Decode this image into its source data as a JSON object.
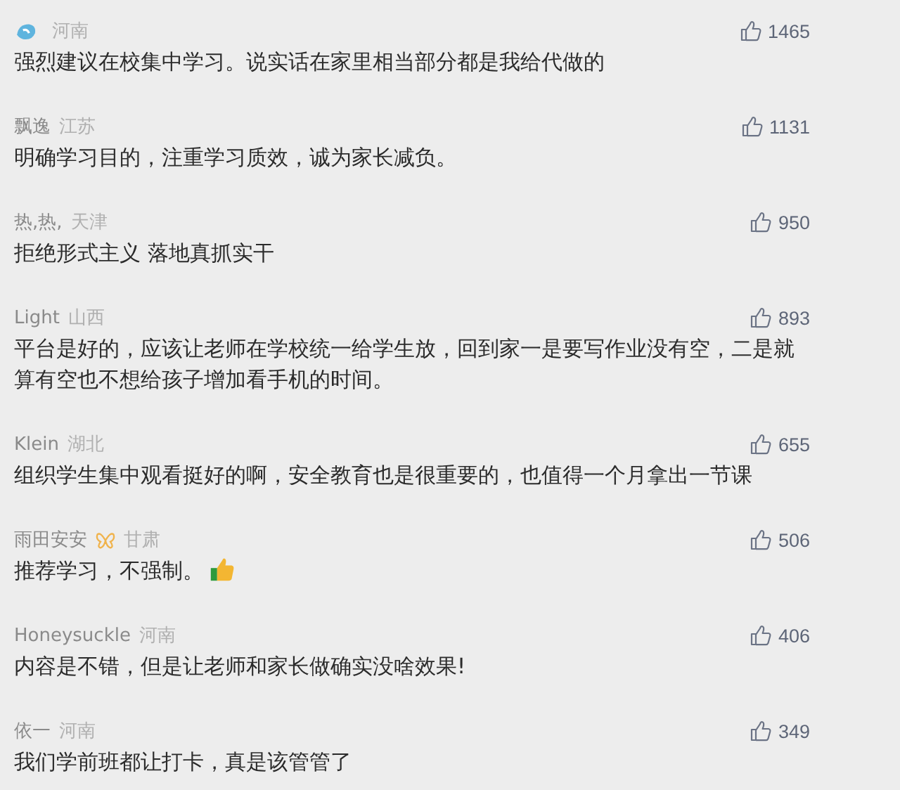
{
  "comments": [
    {
      "kind": "avatar",
      "location": "河南",
      "text": "强烈建议在校集中学习。说实话在家里相当部分都是我给代做的",
      "likes": "1465"
    },
    {
      "kind": "plain",
      "name": "飘逸",
      "location": "江苏",
      "text": "明确学习目的，注重学习质效，诚为家长减负。",
      "likes": "1131"
    },
    {
      "kind": "plain",
      "name": "热,热,",
      "location": "天津",
      "text": "拒绝形式主义 落地真抓实干",
      "likes": "950"
    },
    {
      "kind": "plain",
      "name": "Light",
      "location": "山西",
      "text": "平台是好的，应该让老师在学校统一给学生放，回到家一是要写作业没有空，二是就算有空也不想给孩子增加看手机的时间。",
      "likes": "893"
    },
    {
      "kind": "plain",
      "name": "Klein",
      "location": "湖北",
      "text": "组织学生集中观看挺好的啊，安全教育也是很重要的，也值得一个月拿出一节课",
      "likes": "655"
    },
    {
      "kind": "badged",
      "name": "雨田安安",
      "location": "甘肃",
      "text": "推荐学习，不强制。",
      "likes": "506"
    },
    {
      "kind": "plain",
      "name": "Honeysuckle",
      "location": "河南",
      "text": "内容是不错，但是让老师和家长做确实没啥效果!",
      "likes": "406"
    },
    {
      "kind": "plain",
      "name": "依一",
      "location": "河南",
      "text": "我们学前班都让打卡，真是该管管了",
      "likes": "349"
    }
  ]
}
